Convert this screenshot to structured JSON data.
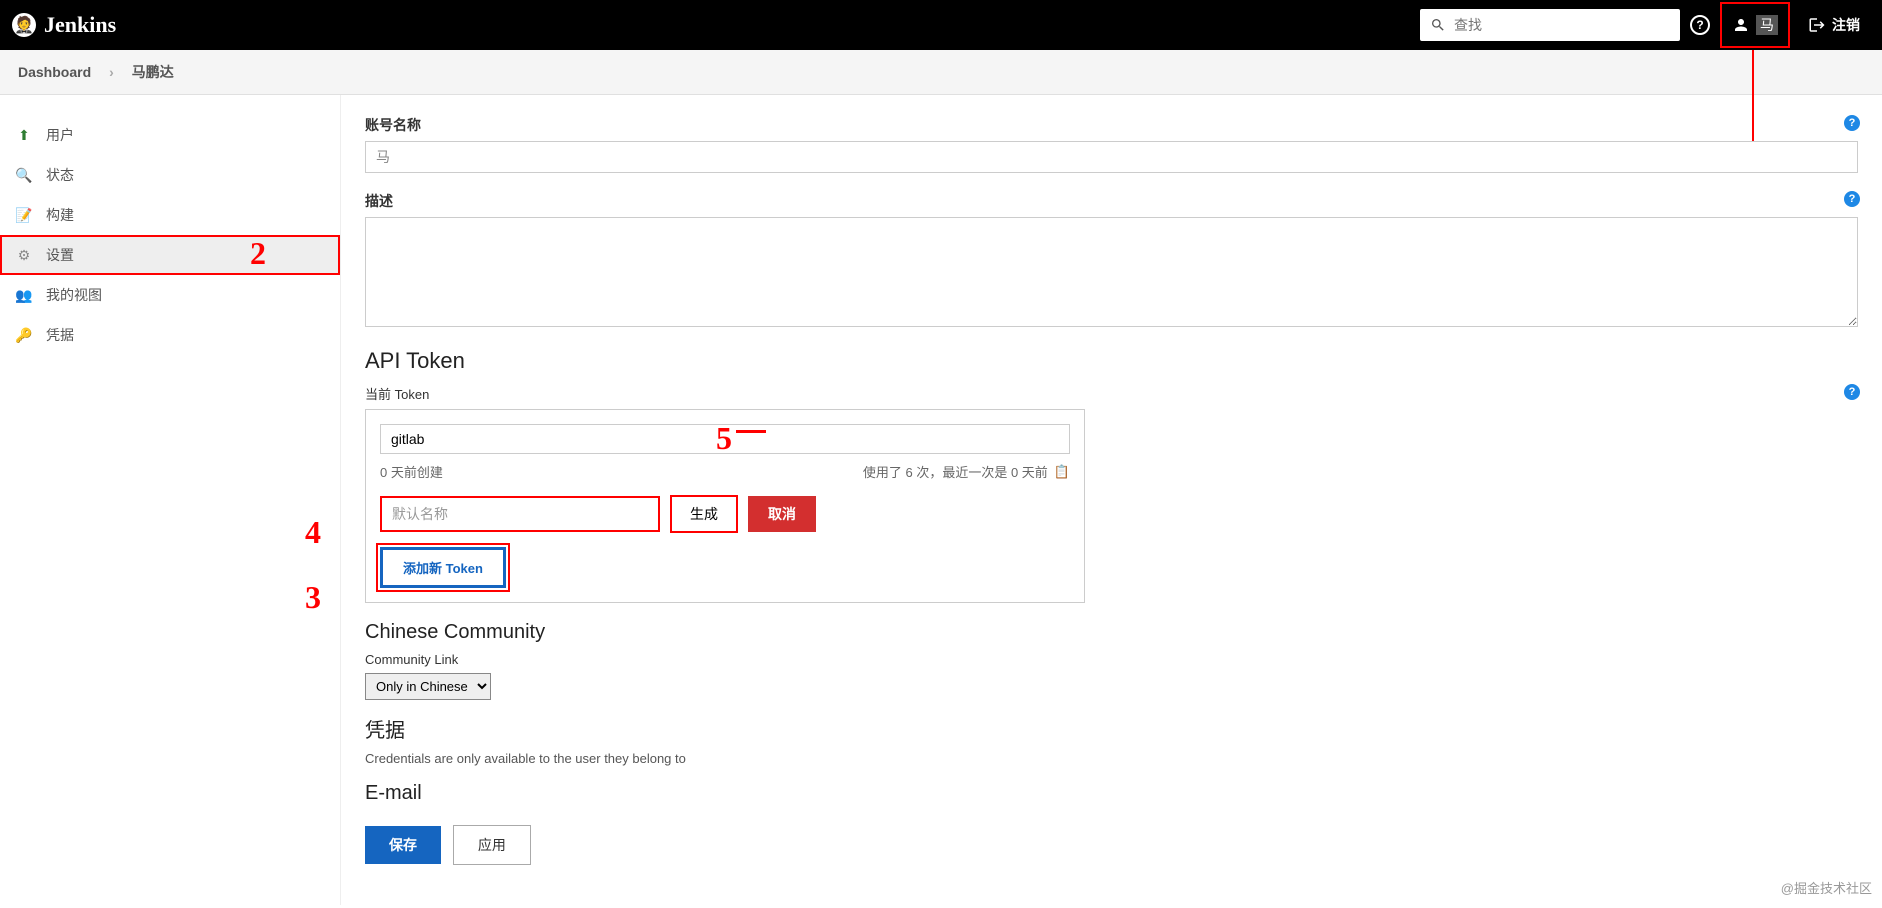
{
  "header": {
    "logo_text": "Jenkins",
    "search_placeholder": "查找",
    "user_name": "马",
    "logout": "注销"
  },
  "breadcrumb": {
    "dashboard": "Dashboard",
    "user": "马鹏达"
  },
  "sidebar": {
    "items": [
      "用户",
      "状态",
      "构建",
      "设置",
      "我的视图",
      "凭据"
    ]
  },
  "main": {
    "account_name_label": "账号名称",
    "account_name_value": "马",
    "description_label": "描述",
    "api_token_heading": "API Token",
    "current_token_label": "当前 Token",
    "existing_token_value": "gitlab",
    "token_created": "0 天前创建",
    "token_usage": "使用了 6 次，最近一次是 0 天前",
    "new_token_placeholder": "默认名称",
    "generate_btn": "生成",
    "cancel_btn": "取消",
    "add_token_btn": "添加新 Token",
    "chinese_community_heading": "Chinese Community",
    "community_link_label": "Community Link",
    "community_link_value": "Only in Chinese",
    "credentials_heading": "凭据",
    "credentials_desc": "Credentials are only available to the user they belong to",
    "email_heading": "E-mail",
    "save_btn": "保存",
    "apply_btn": "应用"
  },
  "watermark": "@掘金技术社区",
  "annotations": {
    "a2": "2",
    "a3": "3",
    "a4": "4",
    "a5": "5"
  }
}
